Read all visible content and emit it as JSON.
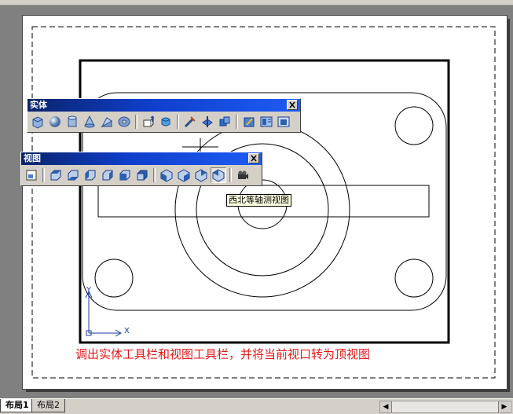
{
  "layout_tabs": [
    {
      "label": "布局1",
      "active": true
    },
    {
      "label": "布局2",
      "active": false
    }
  ],
  "solids_toolbar": {
    "title": "实体",
    "icons": [
      "box-icon",
      "sphere-icon",
      "cylinder-icon",
      "cone-icon",
      "wedge-icon",
      "torus-icon",
      "extrude-icon",
      "revolve-icon",
      "slice-icon",
      "section-icon",
      "interfere-icon",
      "setup-drawing-icon",
      "setup-view-icon",
      "setup-profile-icon"
    ]
  },
  "view_toolbar": {
    "title": "视图",
    "icons": [
      "named-views-icon",
      "top-view-icon",
      "bottom-view-icon",
      "left-view-icon",
      "right-view-icon",
      "front-view-icon",
      "back-view-icon",
      "sw-iso-icon",
      "se-iso-icon",
      "ne-iso-icon",
      "nw-iso-icon",
      "camera-icon"
    ]
  },
  "tooltip": "西北等轴测视图",
  "ucs": {
    "x_label": "X",
    "y_label": "Y"
  },
  "caption": "调出实体工具栏和视图工具栏，并将当前视口转为顶视图",
  "colors": {
    "titlebar": "#0a246a",
    "caption": "#e01818",
    "paper": "#ffffff",
    "background": "#808080"
  }
}
